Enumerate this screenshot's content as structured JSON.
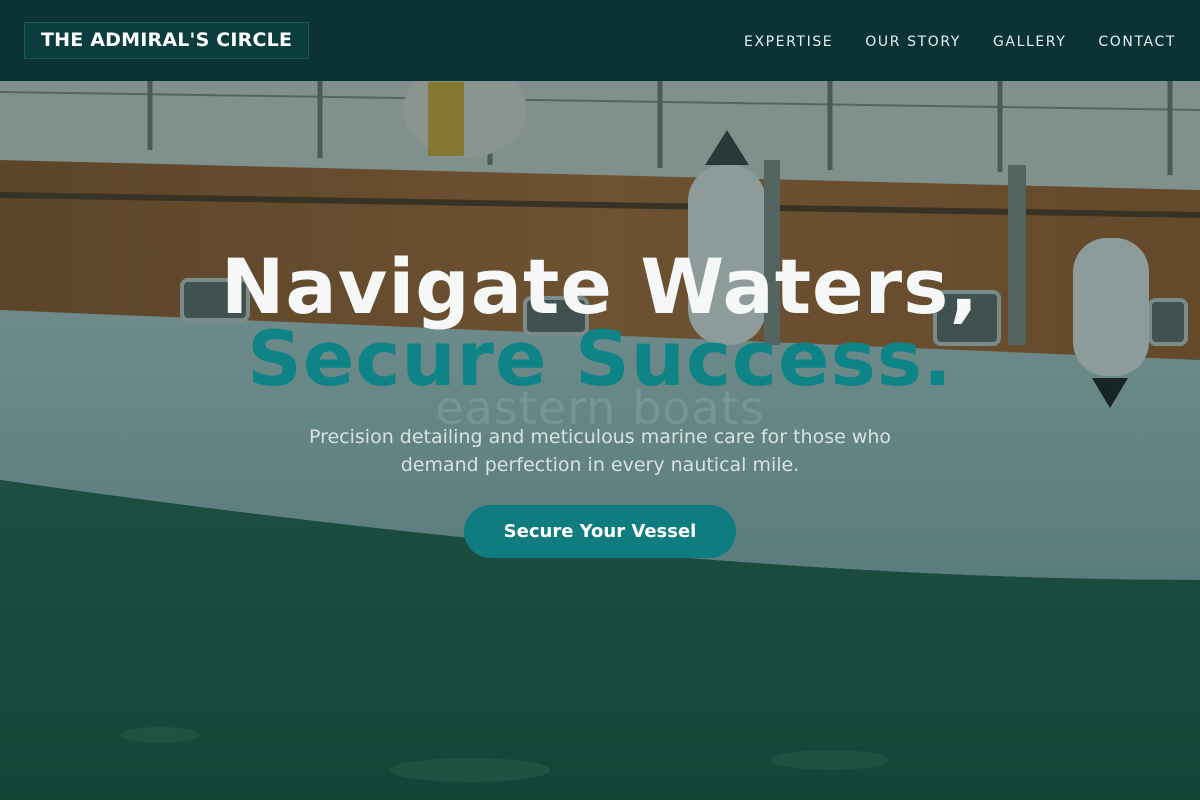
{
  "brand": {
    "name": "THE ADMIRAL'S CIRCLE"
  },
  "nav": {
    "items": [
      {
        "label": "EXPERTISE"
      },
      {
        "label": "OUR STORY"
      },
      {
        "label": "GALLERY"
      },
      {
        "label": "CONTACT"
      }
    ]
  },
  "hero": {
    "headline": "Navigate Waters,",
    "headline_accent": "Secure Success.",
    "background_watermark": "eastern boats",
    "tagline": "Precision detailing and meticulous marine care for those who demand perfection in every nautical mile.",
    "cta_label": "Secure Your Vessel"
  },
  "colors": {
    "nav_background": "#0b3335",
    "accent": "#0f8487",
    "cta_background": "#0f7c80",
    "headline": "#f6f8f8"
  }
}
